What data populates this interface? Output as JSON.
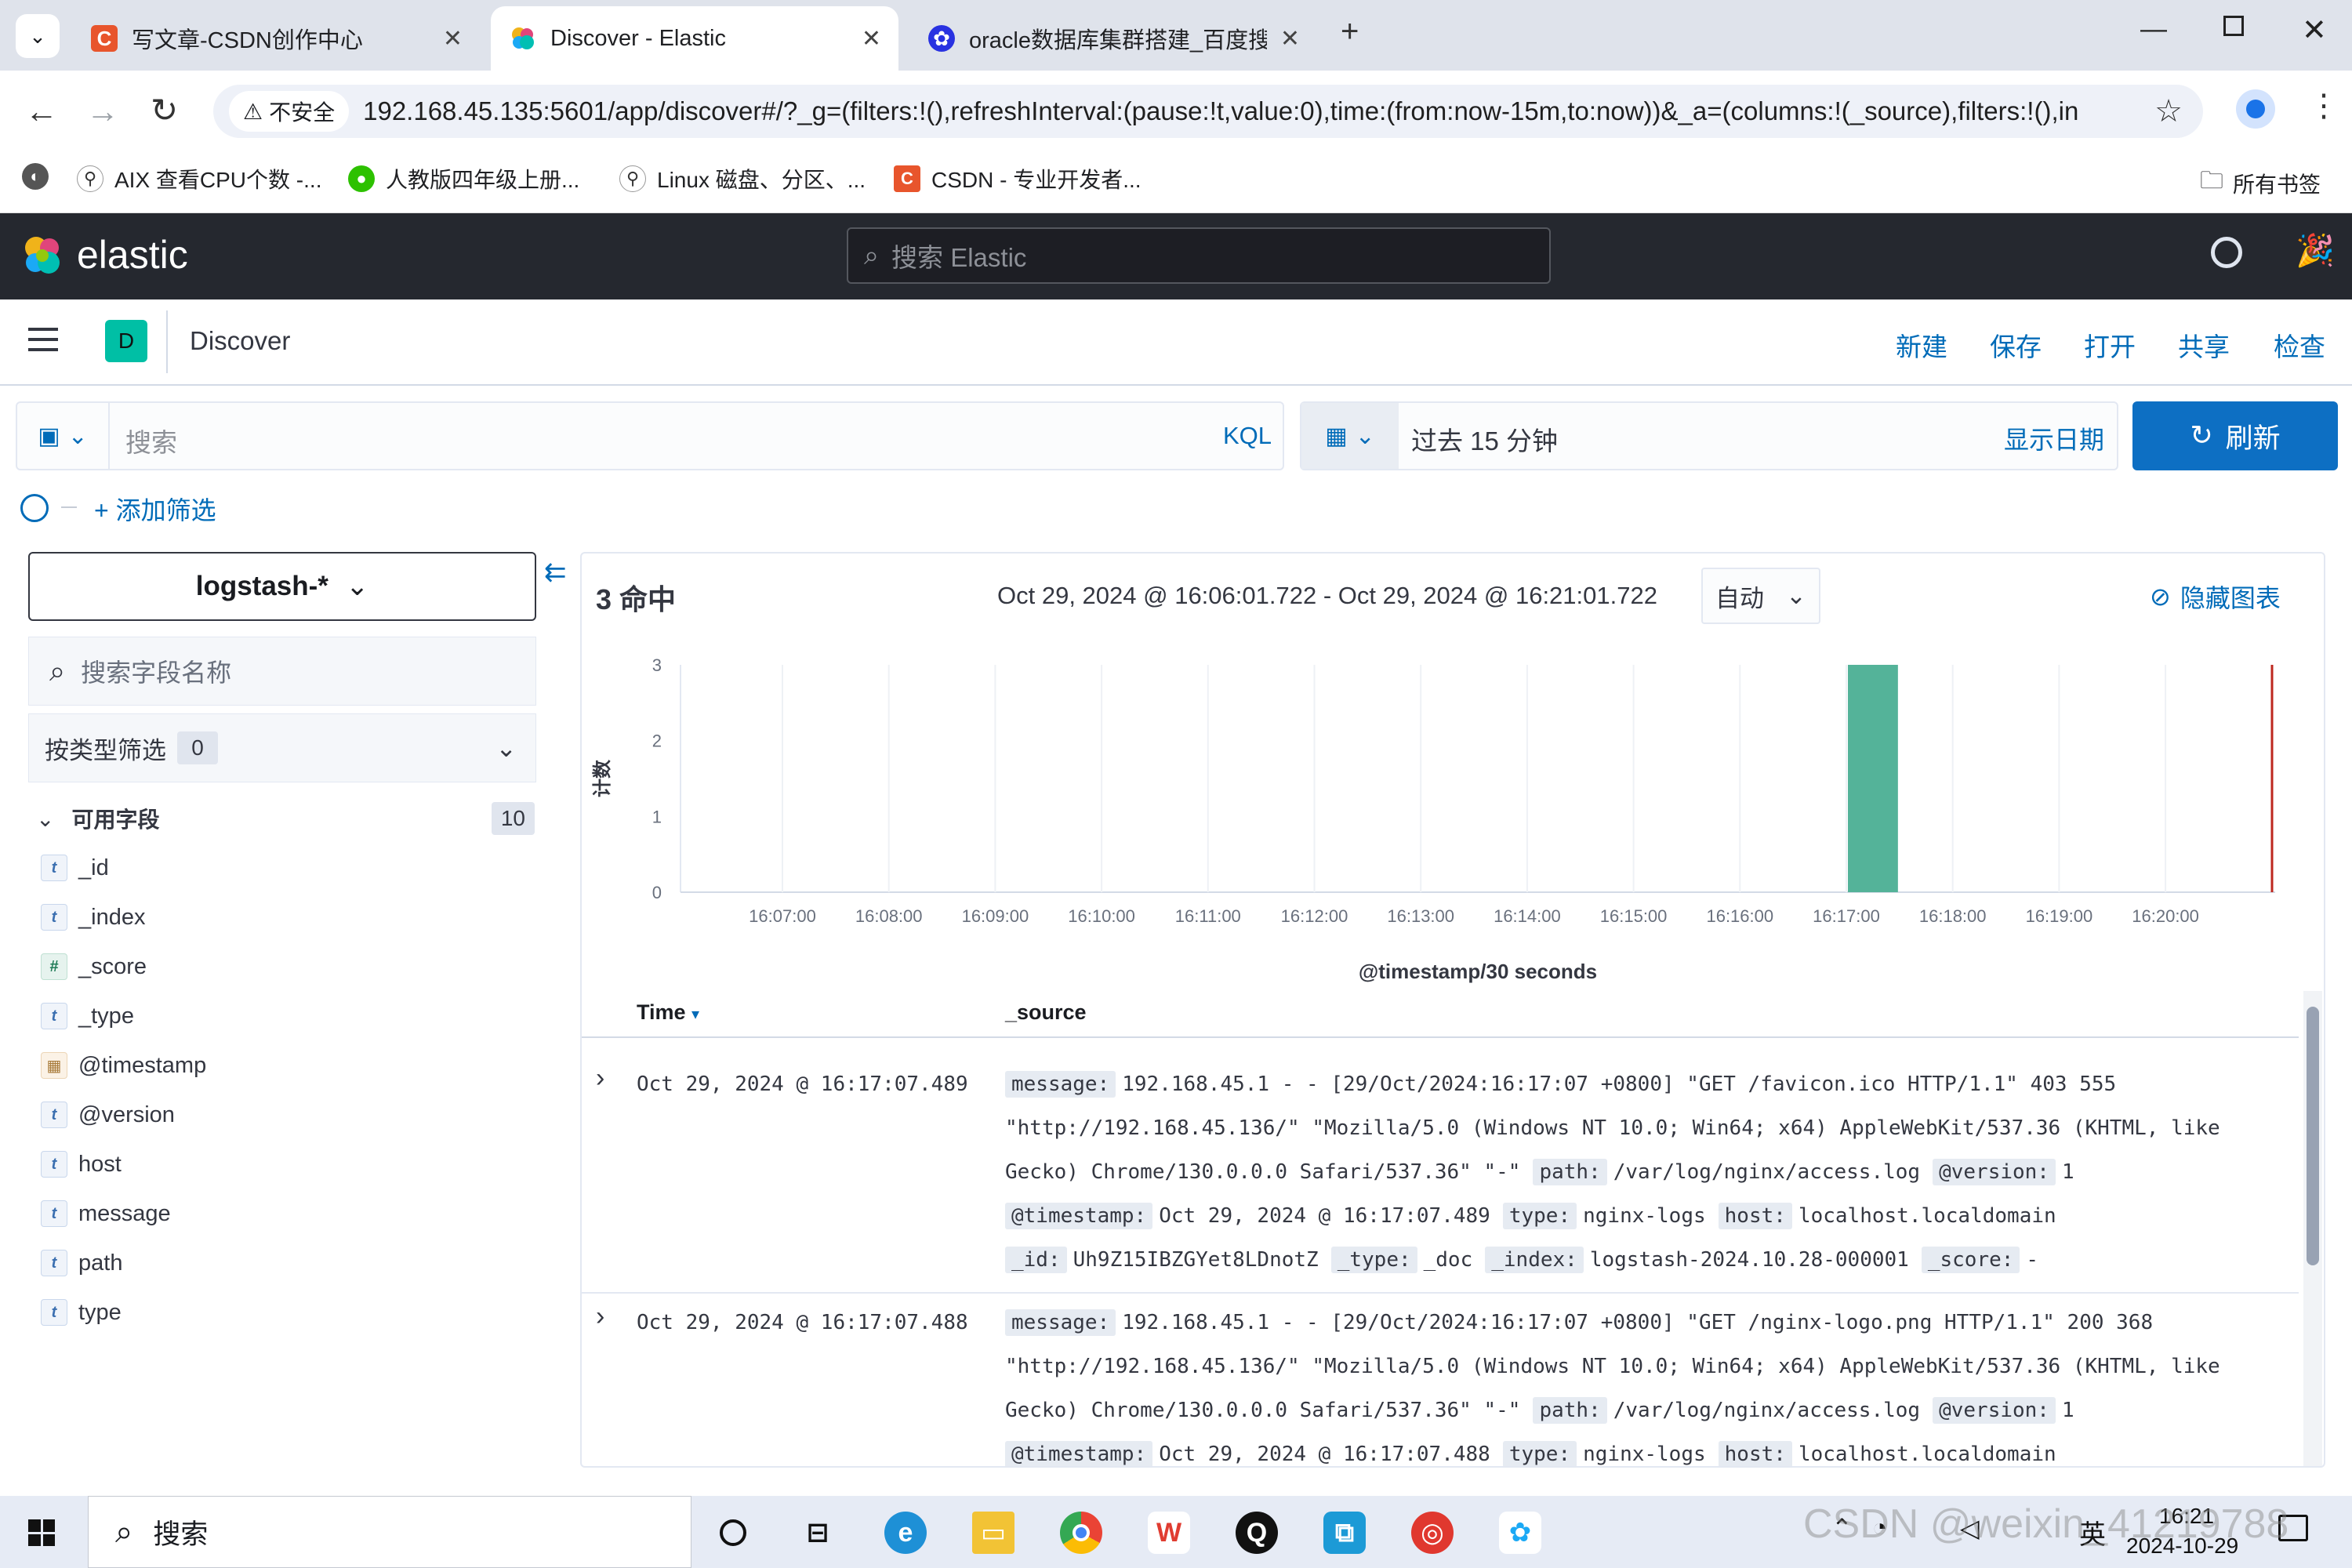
{
  "browser": {
    "tabs": [
      {
        "title": "写文章-CSDN创作中心",
        "icon": "csdn-icon",
        "color": "#e8552c"
      },
      {
        "title": "Discover - Elastic",
        "icon": "elastic-icon",
        "color": "#f0b31a"
      },
      {
        "title": "oracle数据库集群搭建_百度搜",
        "icon": "baidu-icon",
        "color": "#2932e1"
      }
    ],
    "insecure_label": "不安全",
    "url": "192.168.45.135:5601/app/discover#/?_g=(filters:!(),refreshInterval:(pause:!t,value:0),time:(from:now-15m,to:now))&_a=(columns:!(_source),filters:!(),in...",
    "bookmarks": [
      "AIX 查看CPU个数 -...",
      "人教版四年级上册...",
      "Linux 磁盘、分区、...",
      "CSDN - 专业开发者..."
    ],
    "all_bookmarks": "所有书签"
  },
  "elastic": {
    "logo": "elastic",
    "search_placeholder": "搜索 Elastic",
    "space_initial": "D",
    "app_title": "Discover",
    "actions": [
      "新建",
      "保存",
      "打开",
      "共享",
      "检查"
    ],
    "query_placeholder": "搜索",
    "kql": "KQL",
    "time_range": "过去 15 分钟",
    "show_dates": "显示日期",
    "refresh": "刷新",
    "add_filter": "+ 添加筛选"
  },
  "sidebar": {
    "index_pattern": "logstash-*",
    "field_search_placeholder": "搜索字段名称",
    "type_filter_label": "按类型筛选",
    "type_filter_count": "0",
    "available_label": "可用字段",
    "available_count": "10",
    "fields": [
      {
        "type": "t",
        "name": "_id"
      },
      {
        "type": "t",
        "name": "_index"
      },
      {
        "type": "#",
        "name": "_score"
      },
      {
        "type": "t",
        "name": "_type"
      },
      {
        "type": "date",
        "name": "@timestamp"
      },
      {
        "type": "t",
        "name": "@version"
      },
      {
        "type": "t",
        "name": "host"
      },
      {
        "type": "t",
        "name": "message"
      },
      {
        "type": "t",
        "name": "path"
      },
      {
        "type": "t",
        "name": "type"
      }
    ]
  },
  "main": {
    "hits": "3 命中",
    "range": "Oct 29, 2024 @ 16:06:01.722 - Oct 29, 2024 @ 16:21:01.722",
    "interval": "自动",
    "hide_chart": "隐藏图表",
    "col_time": "Time",
    "col_source": "_source"
  },
  "chart_data": {
    "type": "bar",
    "ylabel": "计数",
    "xlabel": "@timestamp/30 seconds",
    "ylim": [
      0,
      3
    ],
    "yticks": [
      "0",
      "1",
      "2",
      "3"
    ],
    "xticks": [
      "16:07:00",
      "16:08:00",
      "16:09:00",
      "16:10:00",
      "16:11:00",
      "16:12:00",
      "16:13:00",
      "16:14:00",
      "16:15:00",
      "16:16:00",
      "16:17:00",
      "16:18:00",
      "16:19:00",
      "16:20:00"
    ],
    "bars": [
      {
        "x": "16:17:00",
        "value": 3
      }
    ],
    "bar_color": "#54b399",
    "now_marker_color": "#bd271e"
  },
  "docs": [
    {
      "time": "Oct 29, 2024 @ 16:17:07.489",
      "lines": [
        [
          [
            "message:",
            "192.168.45.1 - - [29/Oct/2024:16:17:07 +0800] \"GET /favicon.ico HTTP/1.1\" 403 555"
          ]
        ],
        [
          [
            "",
            "\"http://192.168.45.136/\" \"Mozilla/5.0 (Windows NT 10.0; Win64; x64) AppleWebKit/537.36 (KHTML, like"
          ]
        ],
        [
          [
            "",
            "Gecko) Chrome/130.0.0.0 Safari/537.36\" \"-\""
          ],
          [
            "path:",
            "/var/log/nginx/access.log"
          ],
          [
            "@version:",
            "1"
          ]
        ],
        [
          [
            "@timestamp:",
            "Oct 29, 2024 @ 16:17:07.489"
          ],
          [
            "type:",
            "nginx-logs"
          ],
          [
            "host:",
            "localhost.localdomain"
          ]
        ],
        [
          [
            "_id:",
            "Uh9Z15IBZGYet8LDnotZ"
          ],
          [
            "_type:",
            "_doc"
          ],
          [
            "_index:",
            "logstash-2024.10.28-000001"
          ],
          [
            "_score:",
            "-"
          ]
        ]
      ]
    },
    {
      "time": "Oct 29, 2024 @ 16:17:07.488",
      "lines": [
        [
          [
            "message:",
            "192.168.45.1 - - [29/Oct/2024:16:17:07 +0800] \"GET /nginx-logo.png HTTP/1.1\" 200 368"
          ]
        ],
        [
          [
            "",
            "\"http://192.168.45.136/\" \"Mozilla/5.0 (Windows NT 10.0; Win64; x64) AppleWebKit/537.36 (KHTML, like"
          ]
        ],
        [
          [
            "",
            "Gecko) Chrome/130.0.0.0 Safari/537.36\" \"-\""
          ],
          [
            "path:",
            "/var/log/nginx/access.log"
          ],
          [
            "@version:",
            "1"
          ]
        ],
        [
          [
            "@timestamp:",
            "Oct 29, 2024 @ 16:17:07.488"
          ],
          [
            "type:",
            "nginx-logs"
          ],
          [
            "host:",
            "localhost.localdomain"
          ]
        ]
      ]
    }
  ],
  "taskbar": {
    "search_label": "搜索",
    "ime": "英",
    "time": "16:21",
    "date": "2024-10-29",
    "watermark": "CSDN @weixin_41219788"
  }
}
